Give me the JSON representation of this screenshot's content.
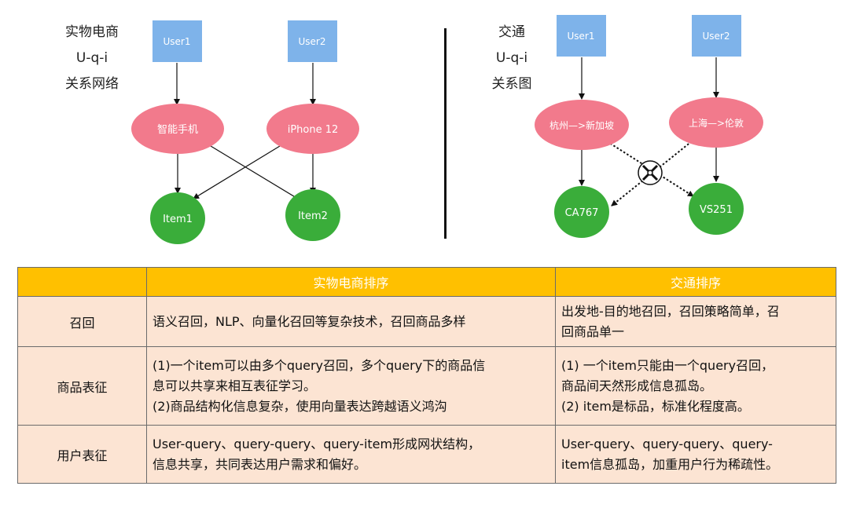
{
  "left_graph": {
    "caption": [
      "实物电商",
      "U-q-i",
      "关系网络"
    ],
    "users": [
      "User1",
      "User2"
    ],
    "queries": [
      "智能手机",
      "iPhone 12"
    ],
    "items": [
      "Item1",
      "Item2"
    ]
  },
  "right_graph": {
    "caption": [
      "交通",
      "U-q-i",
      "关系图"
    ],
    "users": [
      "User1",
      "User2"
    ],
    "queries": [
      "杭州—>新加坡",
      "上海—>伦敦"
    ],
    "items": [
      "CA767",
      "VS251"
    ]
  },
  "colors": {
    "user_box": "#7eb3ea",
    "query_node": "#f27a8c",
    "item_node": "#3aad3a",
    "header_bg": "#ffc000",
    "row_bg": "#fce4d3"
  },
  "table": {
    "headers": [
      "",
      "实物电商排序",
      "交通排序"
    ],
    "rows": [
      {
        "label": "召回",
        "ecommerce": [
          "语义召回，NLP、向量化召回等复杂技术，召回商品多样"
        ],
        "transport": [
          "出发地-目的地召回，召回策略简单，召",
          "回商品单一"
        ]
      },
      {
        "label": "商品表征",
        "ecommerce": [
          "(1)一个item可以由多个query召回，多个query下的商品信",
          "息可以共享来相互表征学习。",
          "(2)商品结构化信息复杂，使用向量表达跨越语义鸿沟"
        ],
        "transport": [
          "(1)  一个item只能由一个query召回，",
          "商品间天然形成信息孤岛。",
          "(2)  item是标品，标准化程度高。"
        ]
      },
      {
        "label": "用户表征",
        "ecommerce": [
          "User-query、query-query、query-item形成网状结构，",
          "信息共享，共同表达用户需求和偏好。"
        ],
        "transport": [
          "User-query、query-query、query-",
          "item信息孤岛，加重用户行为稀疏性。"
        ]
      }
    ]
  }
}
